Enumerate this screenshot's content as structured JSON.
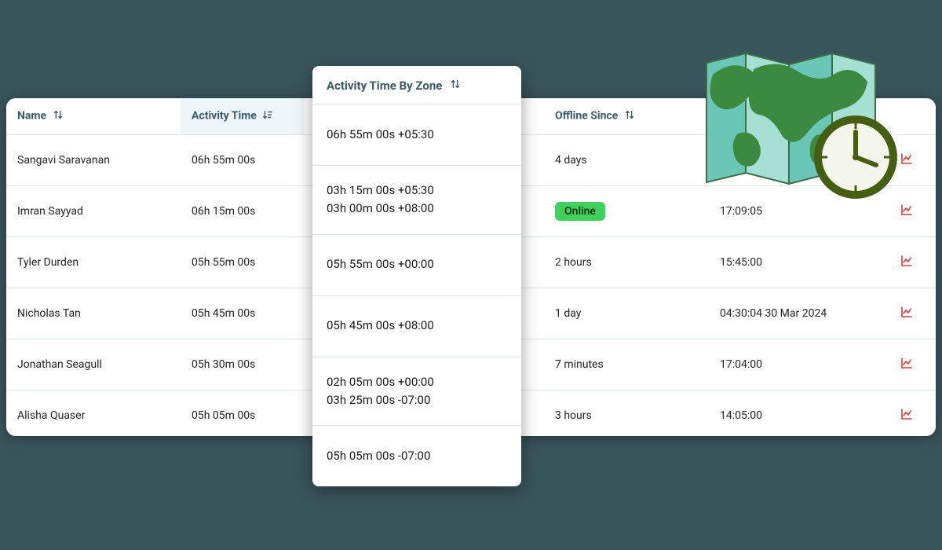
{
  "columns": {
    "name": "Name",
    "activity": "Activity Time",
    "zone": "Activity Time By Zone",
    "offline": "Offline Since",
    "extra": ""
  },
  "online_label": "Online",
  "rows": [
    {
      "name": "Sangavi Saravanan",
      "activity": "06h 55m 00s",
      "zone": [
        "06h 55m 00s +05:30"
      ],
      "offline": "4 days",
      "extra": ""
    },
    {
      "name": "Imran Sayyad",
      "activity": "06h 15m 00s",
      "zone": [
        "03h 15m 00s +05:30",
        "03h 00m 00s +08:00"
      ],
      "offline_online": true,
      "extra": "17:09:05"
    },
    {
      "name": "Tyler Durden",
      "activity": "05h 55m 00s",
      "zone": [
        "05h 55m 00s +00:00"
      ],
      "offline": "2 hours",
      "extra": "15:45:00"
    },
    {
      "name": "Nicholas Tan",
      "activity": "05h 45m 00s",
      "zone": [
        "05h 45m 00s +08:00"
      ],
      "offline": "1 day",
      "extra": "04:30:04 30 Mar 2024"
    },
    {
      "name": "Jonathan Seagull",
      "activity": "05h 30m 00s",
      "zone": [
        "02h 05m 00s +00:00",
        "03h 25m 00s -07:00"
      ],
      "offline": "7 minutes",
      "extra": "17:04:00"
    },
    {
      "name": "Alisha Quaser",
      "activity": "05h 05m 00s",
      "zone": [
        "05h 05m 00s -07:00"
      ],
      "offline": "3 hours",
      "extra": "14:05:00"
    }
  ]
}
